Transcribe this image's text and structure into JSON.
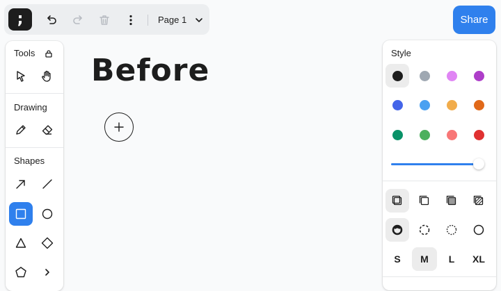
{
  "toolbar": {
    "logo_glyph": ";",
    "icons": [
      "undo-icon",
      "redo-icon",
      "trash-icon",
      "more-vertical-icon",
      "chevron-down-icon"
    ],
    "page_label": "Page 1",
    "share_label": "Share"
  },
  "tools_panel": {
    "tools_title": "Tools",
    "drawing_title": "Drawing",
    "shapes_title": "Shapes",
    "tools": [
      "select-icon",
      "hand-icon",
      "pencil-icon",
      "eraser-icon",
      "arrow-icon",
      "line-icon",
      "rectangle-icon",
      "ellipse-icon",
      "triangle-icon",
      "diamond-icon",
      "pentagon-icon",
      "chevron-right-icon"
    ],
    "selected_tool": "rectangle-icon"
  },
  "style_panel": {
    "title": "Style",
    "colors": [
      "#1d1d1d",
      "#9fa8b2",
      "#e085f4",
      "#ae3ec9",
      "#4465e9",
      "#4ba1f1",
      "#f1ac4b",
      "#e16919",
      "#099268",
      "#4cb05e",
      "#f87777",
      "#e03131"
    ],
    "selected_color": "#1d1d1d",
    "opacity": 1,
    "fill_options": [
      "fill-none-icon",
      "fill-semi-icon",
      "fill-solid-icon",
      "fill-pattern-icon"
    ],
    "dash_options": [
      "dash-draw-icon",
      "dash-dashed-icon",
      "dash-dotted-icon",
      "dash-solid-icon"
    ],
    "sizes": [
      "S",
      "M",
      "L",
      "XL"
    ],
    "selected_size": "M"
  },
  "canvas": {
    "text": "Before"
  }
}
